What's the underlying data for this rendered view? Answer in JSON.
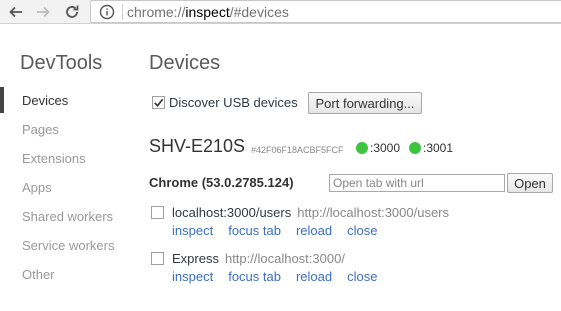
{
  "browser": {
    "url_scheme": "chrome://",
    "url_host": "inspect",
    "url_path": "/#devices"
  },
  "sidebar": {
    "title": "DevTools",
    "items": [
      {
        "label": "Devices",
        "selected": true
      },
      {
        "label": "Pages",
        "selected": false
      },
      {
        "label": "Extensions",
        "selected": false
      },
      {
        "label": "Apps",
        "selected": false
      },
      {
        "label": "Shared workers",
        "selected": false
      },
      {
        "label": "Service workers",
        "selected": false
      },
      {
        "label": "Other",
        "selected": false
      }
    ]
  },
  "main": {
    "title": "Devices",
    "discover_usb_label": "Discover USB devices",
    "discover_usb_checked": true,
    "port_forwarding_label": "Port forwarding...",
    "device": {
      "name": "SHV-E210S",
      "serial": "#42F06F18ACBF5FCF",
      "ports": [
        ":3000",
        ":3001"
      ],
      "port_status_color": "#3ec43e"
    },
    "browser": {
      "name": "Chrome (53.0.2785.124)",
      "open_tab_placeholder": "Open tab with url",
      "open_button_label": "Open"
    },
    "targets": [
      {
        "title": "localhost:3000/users",
        "url": "http://localhost:3000/users",
        "actions": [
          "inspect",
          "focus tab",
          "reload",
          "close"
        ]
      },
      {
        "title": "Express",
        "url": "http://localhost:3000/",
        "actions": [
          "inspect",
          "focus tab",
          "reload",
          "close"
        ]
      }
    ]
  },
  "colors": {
    "link": "#3b6fc6",
    "port_ok": "#3ec43e"
  }
}
